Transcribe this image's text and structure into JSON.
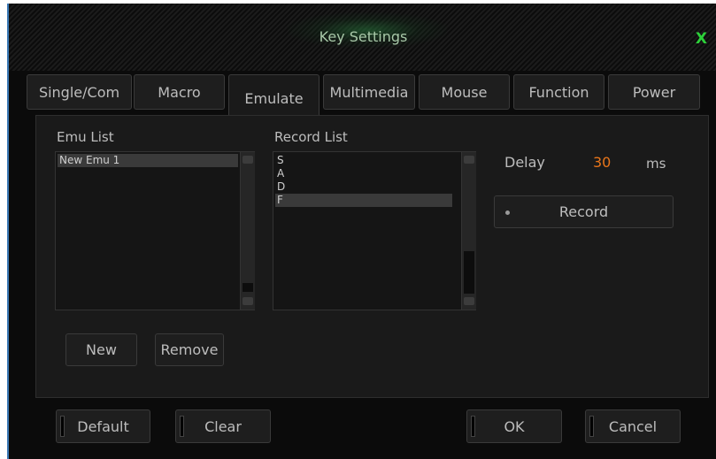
{
  "window": {
    "title": "Key Settings",
    "close_label": "X"
  },
  "tabs": [
    {
      "label": "Single/Com",
      "active": false
    },
    {
      "label": "Macro",
      "active": false
    },
    {
      "label": "Emulate",
      "active": true
    },
    {
      "label": "Multimedia",
      "active": false
    },
    {
      "label": "Mouse",
      "active": false
    },
    {
      "label": "Function",
      "active": false
    },
    {
      "label": "Power",
      "active": false
    }
  ],
  "emu": {
    "label": "Emu List",
    "items": [
      "New Emu 1"
    ],
    "selected_index": 0
  },
  "record": {
    "label": "Record List",
    "items": [
      "S",
      "A",
      "D",
      "F"
    ],
    "selected_index": 3
  },
  "delay": {
    "label": "Delay",
    "value": "30",
    "unit": "ms"
  },
  "buttons": {
    "record": "Record",
    "new": "New",
    "remove": "Remove",
    "default": "Default",
    "clear": "Clear",
    "ok": "OK",
    "cancel": "Cancel"
  },
  "colors": {
    "accent_green": "#2dd03a",
    "delay_value": "#e8751a",
    "window_border": "#3a78b4"
  }
}
